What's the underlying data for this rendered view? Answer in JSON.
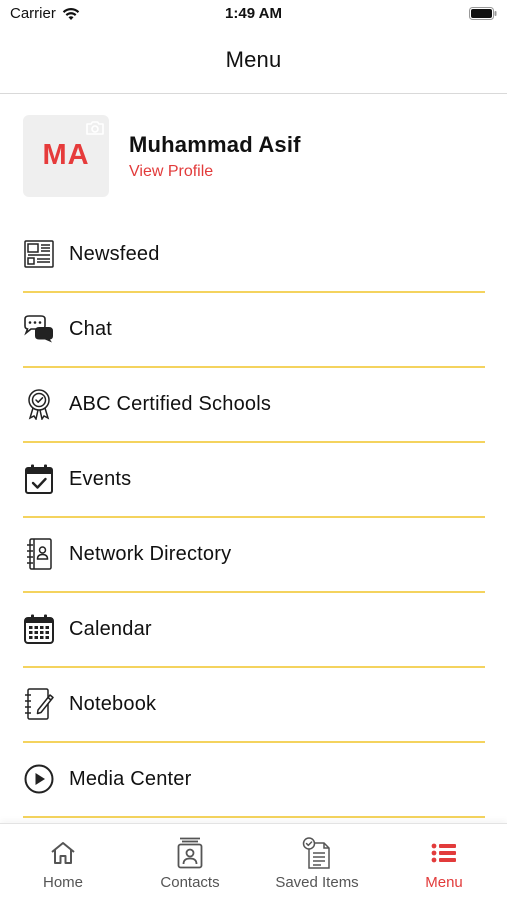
{
  "status_bar": {
    "carrier": "Carrier",
    "time": "1:49 AM"
  },
  "nav": {
    "title": "Menu"
  },
  "profile": {
    "initials": "MA",
    "name": "Muhammad Asif",
    "link": "View Profile"
  },
  "menu": [
    {
      "label": "Newsfeed",
      "icon": "newspaper-icon"
    },
    {
      "label": "Chat",
      "icon": "chat-bubbles-icon"
    },
    {
      "label": "ABC Certified Schools",
      "icon": "certificate-badge-icon"
    },
    {
      "label": "Events",
      "icon": "calendar-check-icon"
    },
    {
      "label": "Network Directory",
      "icon": "contact-book-icon"
    },
    {
      "label": "Calendar",
      "icon": "calendar-grid-icon"
    },
    {
      "label": "Notebook",
      "icon": "notebook-pencil-icon"
    },
    {
      "label": "Media Center",
      "icon": "play-circle-icon"
    }
  ],
  "tabs": [
    {
      "label": "Home",
      "icon": "home-icon"
    },
    {
      "label": "Contacts",
      "icon": "contacts-icon"
    },
    {
      "label": "Saved Items",
      "icon": "saved-items-icon"
    },
    {
      "label": "Menu",
      "icon": "menu-list-icon",
      "active": true
    }
  ],
  "colors": {
    "accent": "#e23b3b",
    "divider": "#f4d35e",
    "avatar_bg": "#efefef"
  }
}
